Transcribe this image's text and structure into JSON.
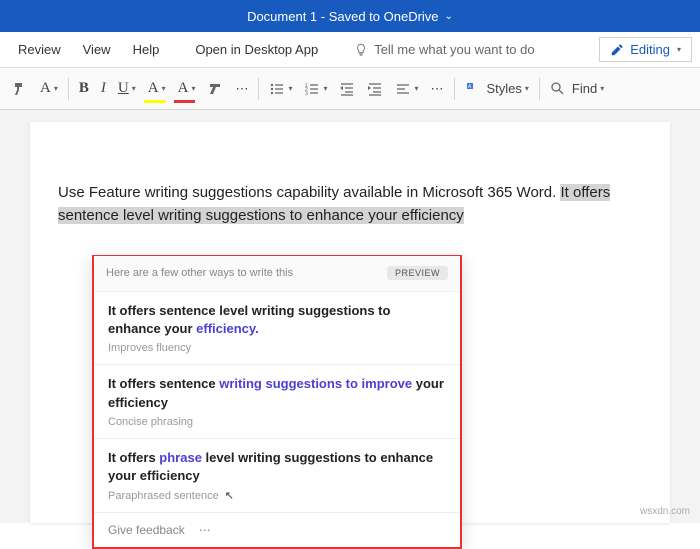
{
  "titlebar": {
    "title": "Document 1 - Saved to OneDrive"
  },
  "menu": {
    "review": "Review",
    "view": "View",
    "help": "Help",
    "desktop": "Open in Desktop App",
    "tell": "Tell me what you want to do",
    "editing": "Editing"
  },
  "toolbar": {
    "bold": "B",
    "italic": "I",
    "underline": "U",
    "font_color": "A",
    "highlight": "A",
    "styles": "Styles",
    "find": "Find"
  },
  "document": {
    "line1": "Use Feature writing suggestions capability available in Microsoft 365 Word. ",
    "line1_hl": "It offers sentence level writing suggestions to enhance your efficiency"
  },
  "suggestions": {
    "header": "Here are a few other ways to write this",
    "badge": "PREVIEW",
    "items": [
      {
        "pre": "It offers sentence level writing suggestions to enhance your ",
        "accent": "efficiency.",
        "post": "",
        "sub": "Improves fluency"
      },
      {
        "pre": "It offers sentence ",
        "accent": "writing suggestions to improve",
        "post": " your efficiency",
        "sub": "Concise phrasing"
      },
      {
        "pre": "It offers ",
        "accent": "phrase",
        "post": " level writing suggestions to enhance your efficiency",
        "sub": "Paraphrased sentence"
      }
    ],
    "feedback": "Give feedback"
  },
  "watermark": "wsxdn.com"
}
